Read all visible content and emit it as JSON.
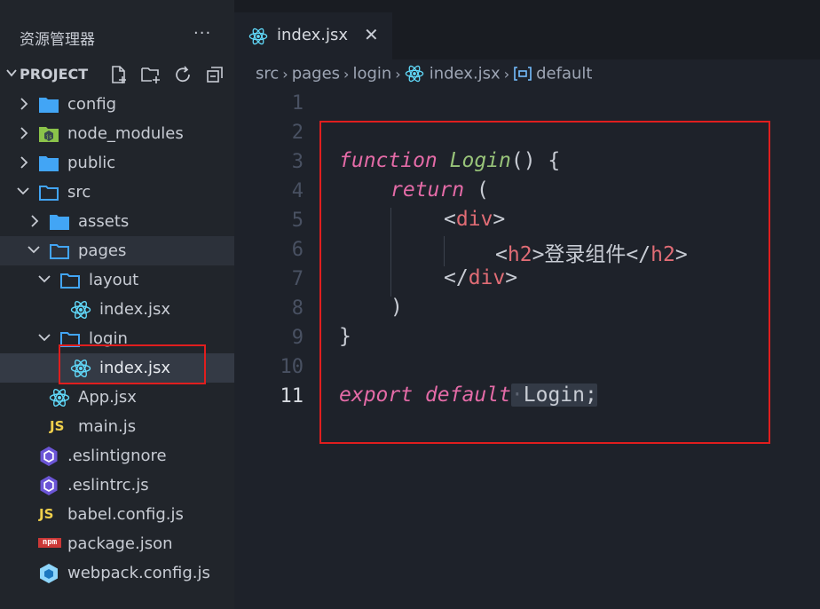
{
  "sidebar": {
    "title": "资源管理器",
    "more": "···",
    "project_label": "PROJECT",
    "items": [
      {
        "label": "config",
        "icon": "folder-icon"
      },
      {
        "label": "node_modules",
        "icon": "nodejs-folder-icon"
      },
      {
        "label": "public",
        "icon": "folder-icon"
      },
      {
        "label": "src",
        "icon": "folder-open-icon"
      },
      {
        "label": "assets",
        "icon": "folder-icon"
      },
      {
        "label": "pages",
        "icon": "folder-open-icon"
      },
      {
        "label": "layout",
        "icon": "folder-open-icon"
      },
      {
        "label": "index.jsx",
        "icon": "react-icon"
      },
      {
        "label": "login",
        "icon": "folder-open-icon"
      },
      {
        "label": "index.jsx",
        "icon": "react-icon"
      },
      {
        "label": "App.jsx",
        "icon": "react-icon"
      },
      {
        "label": "main.js",
        "icon": "js-icon"
      },
      {
        "label": ".eslintignore",
        "icon": "eslint-icon"
      },
      {
        "label": ".eslintrc.js",
        "icon": "eslint-icon"
      },
      {
        "label": "babel.config.js",
        "icon": "js-icon"
      },
      {
        "label": "package.json",
        "icon": "npm-icon"
      },
      {
        "label": "webpack.config.js",
        "icon": "webpack-icon"
      }
    ],
    "js_badge": "JS",
    "npm_badge": "npm"
  },
  "tab": {
    "label": "index.jsx",
    "close": "✕"
  },
  "breadcrumb": {
    "parts": [
      "src",
      "pages",
      "login",
      "index.jsx",
      "default"
    ],
    "separator": "›"
  },
  "editor": {
    "line_numbers": [
      "1",
      "2",
      "3",
      "4",
      "5",
      "6",
      "7",
      "8",
      "9",
      "10",
      "11"
    ],
    "current_line": "11",
    "tokens": {
      "function_kw": "function",
      "login_name": "Login",
      "paren_brace": "() {",
      "return_kw": "return",
      "open_paren": "(",
      "lt": "<",
      "gt": ">",
      "lt_slash": "</",
      "div": "div",
      "h2": "h2",
      "h2_text": "登录组件",
      "close_paren": ")",
      "close_brace": "}",
      "export_kw": "export",
      "default_kw": "default",
      "dot": "·",
      "export_name": "Login",
      "semicolon": ";"
    }
  },
  "colors": {
    "accent_red_box": "#e01e1e",
    "react": "#61dafb",
    "folder": "#42a5f5",
    "js_yellow": "#f0d04c",
    "eslint": "#6b55d6",
    "npm_red": "#cb3837"
  }
}
